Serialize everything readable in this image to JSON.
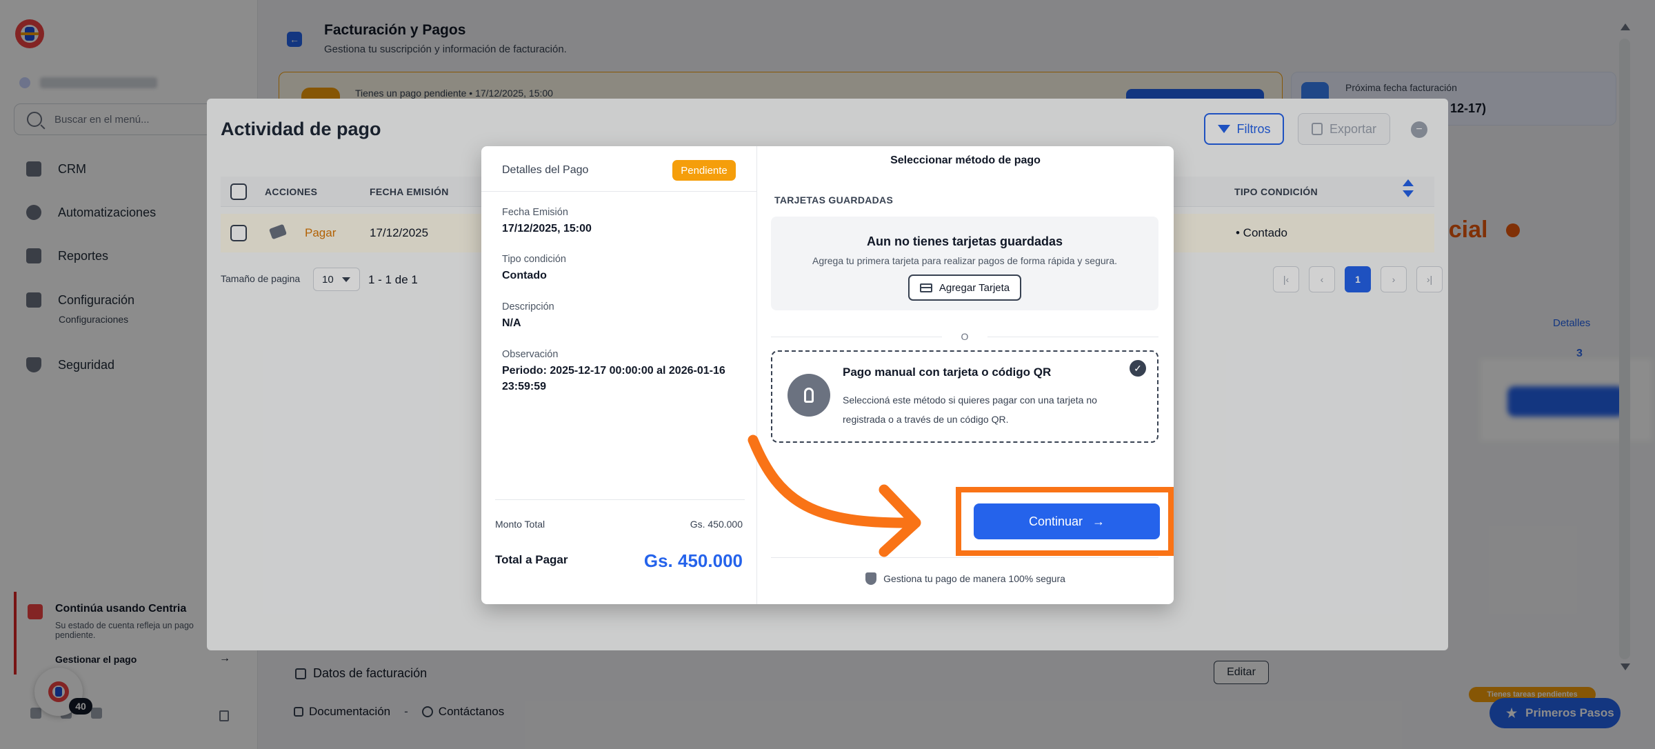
{
  "sidebar": {
    "search_placeholder": "Buscar en el menú...",
    "items": [
      {
        "label": "CRM"
      },
      {
        "label": "Automatizaciones"
      },
      {
        "label": "Reportes"
      },
      {
        "label": "Configuración",
        "sub": "Configuraciones"
      },
      {
        "label": "Seguridad"
      }
    ],
    "promo": {
      "title": "Continúa usando Centria",
      "desc": "Su estado de cuenta refleja un pago pendiente.",
      "link": "Gestionar el pago",
      "arrow": "→"
    },
    "chat_badge": "40"
  },
  "page": {
    "back_icon": "←",
    "title": "Facturación y Pagos",
    "subtitle": "Gestiona tu suscripción y información de facturación.",
    "pending_text": "Tienes un pago pendiente • 17/12/2025, 15:00",
    "next_billing_label": "Próxima fecha facturación",
    "next_billing_value": "12-17)",
    "plan_title": "ncial",
    "details_link": "Detalles",
    "details_count": "3",
    "billing_data": "Datos de facturación",
    "edit": "Editar",
    "footer": {
      "docs": "Documentación",
      "sep": "-",
      "contact": "Contáctanos"
    },
    "tasks_pending": "Tienes tareas pendientes",
    "first_steps": "Primeros Pasos"
  },
  "activity": {
    "title": "Actividad de pago",
    "filters": "Filtros",
    "export": "Exportar",
    "close": "−",
    "columns": [
      "ACCIONES",
      "FECHA EMISIÓN",
      "TIPO CONDICIÓN"
    ],
    "row": {
      "action": "Pagar",
      "date": "17/12/2025",
      "condition": "• Contado"
    },
    "page_size_label": "Tamaño de pagina",
    "page_size": "10",
    "range": "1 - 1 de 1",
    "pager": [
      "|‹",
      "‹",
      "1",
      "›",
      "›|"
    ]
  },
  "modal": {
    "details_title": "Detalles del Pago",
    "status": "Pendiente",
    "fields": [
      {
        "label": "Fecha Emisión",
        "value": "17/12/2025, 15:00"
      },
      {
        "label": "Tipo condición",
        "value": "Contado"
      },
      {
        "label": "Descripción",
        "value": "N/A"
      },
      {
        "label": "Observación",
        "value": "Periodo: 2025-12-17 00:00:00 al 2026-01-16 23:59:59"
      }
    ],
    "amount_label": "Monto Total",
    "amount_value": "Gs. 450.000",
    "total_label": "Total a Pagar",
    "total_value": "Gs. 450.000",
    "method_title": "Seleccionar método de pago",
    "saved_cards_label": "TARJETAS GUARDADAS",
    "no_cards_title": "Aun no tienes tarjetas guardadas",
    "no_cards_desc": "Agrega tu primera tarjeta para realizar pagos de forma rápida y segura.",
    "add_card": "Agregar Tarjeta",
    "or": "O",
    "manual_title": "Pago manual con tarjeta o código QR",
    "manual_desc": "Seleccioná este método si quieres pagar con una tarjeta no registrada o a través de un código QR.",
    "manual_check": "✓",
    "continue": "Continuar",
    "continue_arrow": "→",
    "secure": "Gestiona tu pago de manera 100% segura"
  },
  "colors": {
    "primary": "#2563eb",
    "pending": "#f59e0b",
    "highlight": "#f97316"
  }
}
